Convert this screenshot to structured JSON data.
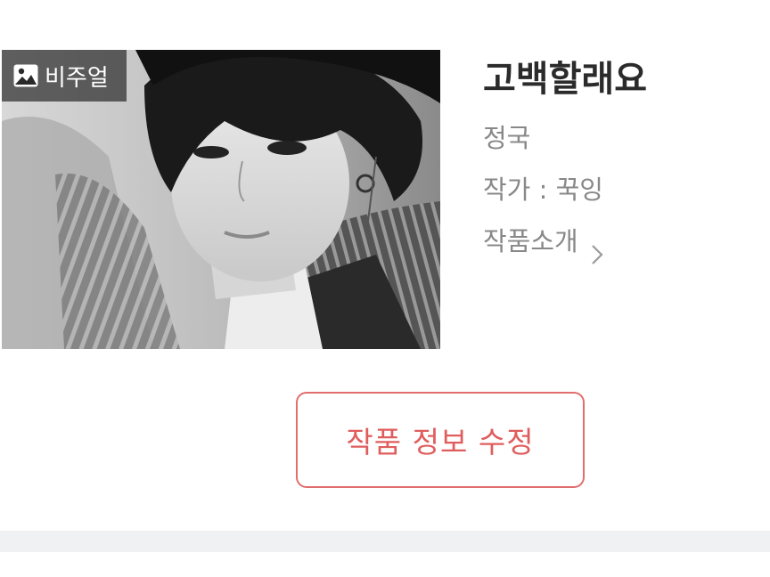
{
  "cover": {
    "badge_label": "비주얼",
    "badge_icon": "image-icon"
  },
  "work": {
    "title": "고백할래요",
    "character": "정국",
    "author": "작가 : 꾹잉",
    "intro_label": "작품소개",
    "intro_icon": "chevron-right-icon"
  },
  "actions": {
    "edit_label": "작품 정보 수정"
  },
  "colors": {
    "accent": "#e05d5d",
    "meta_text": "#888888",
    "title_text": "#2b2b2b",
    "divider": "#f0f1f3"
  }
}
